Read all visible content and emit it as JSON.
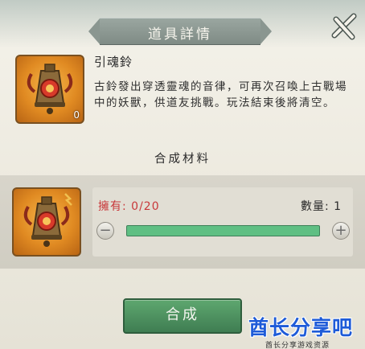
{
  "title": "道具詳情",
  "item": {
    "name": "引魂鈴",
    "count": "0",
    "description": "古鈴發出穿透靈魂的音律，可再次召喚上古戰場中的妖獸，供道友挑戰。玩法結束後將清空。"
  },
  "materials": {
    "heading": "合成材料",
    "owned_label": "擁有: 0/20",
    "quantity_label": "數量: 1",
    "minus_icon": "minus-icon",
    "plus_icon": "plus-icon"
  },
  "synthesize_button": "合成",
  "watermark": {
    "main": "酋长分享吧",
    "sub": "酋长分享游戏资源"
  },
  "colors": {
    "accent_green": "#5fbf83",
    "owned_red": "#c8383a",
    "button_green": "#4a8e5e"
  }
}
